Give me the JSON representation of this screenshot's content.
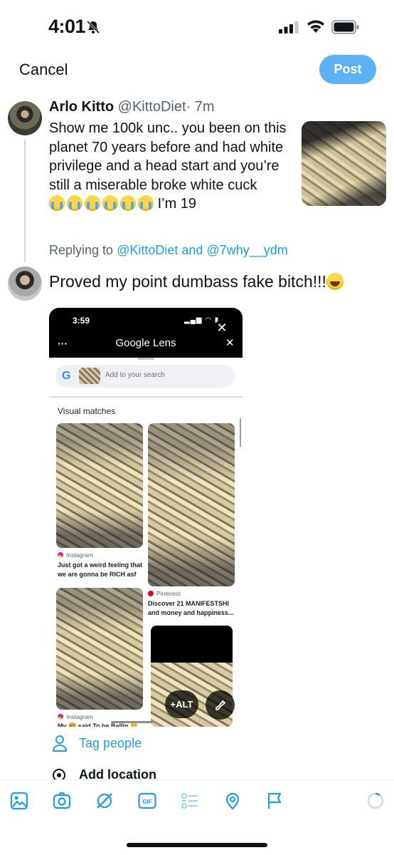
{
  "status_bar": {
    "time": "4:01"
  },
  "header": {
    "cancel_label": "Cancel",
    "post_label": "Post"
  },
  "original_tweet": {
    "name": "Arlo Kitto",
    "handle": "@KittoDiet",
    "time": "· 7m",
    "text": "Show me 100k unc.. you been on this planet 70 years before and had white privilege and a head start and you’re still a miserable broke white cuck",
    "text_tail": "I’m 19"
  },
  "reply_context": {
    "prefix": "Replying to",
    "mention1": "@KittoDiet",
    "conjunction": "and",
    "mention2": "@7why__ydm"
  },
  "reply": {
    "text": "Proved my point dumbass fake bitch!!!"
  },
  "attachment": {
    "time": "3:59",
    "app_title": "Google Lens",
    "search_placeholder": "Add to your search",
    "section_title": "Visual matches",
    "results": [
      {
        "source": "Instagram",
        "title": "Just got a weird feeling that we are gonna be RICH asf"
      },
      {
        "source": "Pinterest",
        "title": "Discover 21 MANIFESTSHI and money and happiness..."
      },
      {
        "source": "Instagram",
        "title": "My 🤬 said To be Ballin 🤑"
      }
    ],
    "alt_label": "+ALT"
  },
  "composer_options": {
    "tag_people": "Tag people",
    "add_location": "Add location"
  },
  "colors": {
    "accent": "#1d9bf0",
    "post_button": "#5db2f3"
  },
  "toolbar_icons": [
    "image-icon",
    "camera-icon",
    "grok-icon",
    "gif-icon",
    "poll-icon",
    "location-icon",
    "flag-icon",
    "char-count-ring-icon"
  ]
}
